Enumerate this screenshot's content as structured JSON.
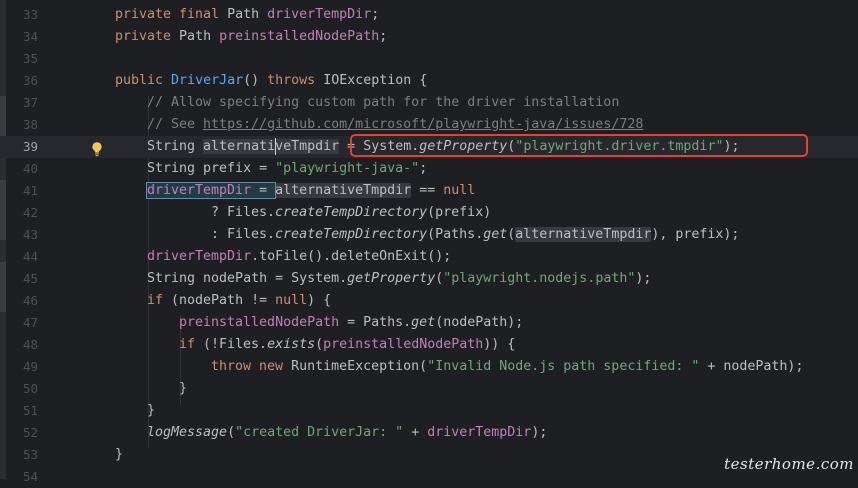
{
  "editor": {
    "line_numbers": [
      "33",
      "34",
      "35",
      "36",
      "37",
      "38",
      "39",
      "40",
      "41",
      "42",
      "43",
      "44",
      "45",
      "46",
      "47",
      "48",
      "49",
      "50",
      "51",
      "52",
      "53",
      "54"
    ],
    "current_line": "39",
    "l33": {
      "kw": "private final",
      "type": " Path ",
      "field": "driverTempDir",
      "end": ";"
    },
    "l34": {
      "kw": "private",
      "type": " Path ",
      "field": "preinstalledNodePath",
      "end": ";"
    },
    "l36": {
      "kw1": "public ",
      "name": "DriverJar",
      "paren": "() ",
      "kw2": "throws",
      "rest": " IOException {"
    },
    "l37": {
      "comment": "// Allow specifying custom path for the driver installation"
    },
    "l38": {
      "comment_prefix": "// See ",
      "url": "https://github.com/microsoft/playwright-java/issues/728"
    },
    "l39": {
      "type": "String ",
      "var_a": "alternati",
      "var_b": "veTmpdir",
      "assign": " = ",
      "cls": "System.",
      "method": "getProperty",
      "open": "(",
      "str": "\"playwright.driver.tmpdir\"",
      "close": ");"
    },
    "l40": {
      "pre": "String prefix = ",
      "str": "\"playwright-java-\"",
      "end": ";"
    },
    "l41": {
      "field": "driverTempDir",
      "assign": " = ",
      "var": "alternativeTmpdir",
      "op": " == ",
      "kw": "null"
    },
    "l42": {
      "pre": "? Files.",
      "method": "createTempDirectory",
      "rest": "(prefix)"
    },
    "l43": {
      "pre": ": Files.",
      "method": "createTempDirectory",
      "mid": "(Paths.",
      "method2": "get",
      "open": "(",
      "var": "alternativeTmpdir",
      "rest": "), prefix);"
    },
    "l44": {
      "field": "driverTempDir",
      "rest": ".toFile().deleteOnExit();"
    },
    "l45": {
      "pre": "String nodePath = System.",
      "method": "getProperty",
      "open": "(",
      "str": "\"playwright.nodejs.path\"",
      "end": ");"
    },
    "l46": {
      "kw": "if",
      "mid": " (nodePath != ",
      "kw2": "null",
      "end": ") {"
    },
    "l47": {
      "field": "preinstalledNodePath",
      "mid": " = Paths.",
      "method": "get",
      "rest": "(nodePath);"
    },
    "l48": {
      "kw": "if",
      "mid": " (!Files.",
      "method": "exists",
      "open": "(",
      "field": "preinstalledNodePath",
      "end": ")) {"
    },
    "l49": {
      "kw1": "throw",
      "sp": " ",
      "kw2": "new",
      "mid": " RuntimeException(",
      "str": "\"Invalid Node.js path specified: \"",
      "end": " + nodePath);"
    },
    "l50": {
      "text": "}"
    },
    "l51": {
      "text": "}"
    },
    "l52": {
      "method": "logMessage",
      "open": "(",
      "str": "\"created DriverJar: \"",
      "mid": " + ",
      "field": "driverTempDir",
      "end": ");"
    },
    "l53": {
      "text": "}"
    }
  },
  "watermark": "testerhome.com",
  "icons": {
    "gutter": "lightbulb-icon"
  },
  "colors": {
    "background": "#1e1f22",
    "keyword": "#cf8e6d",
    "field": "#c77dbb",
    "method": "#56a8f5",
    "string": "#6aab73",
    "comment": "#7a7e85",
    "annotation_box": "#e8412b"
  }
}
